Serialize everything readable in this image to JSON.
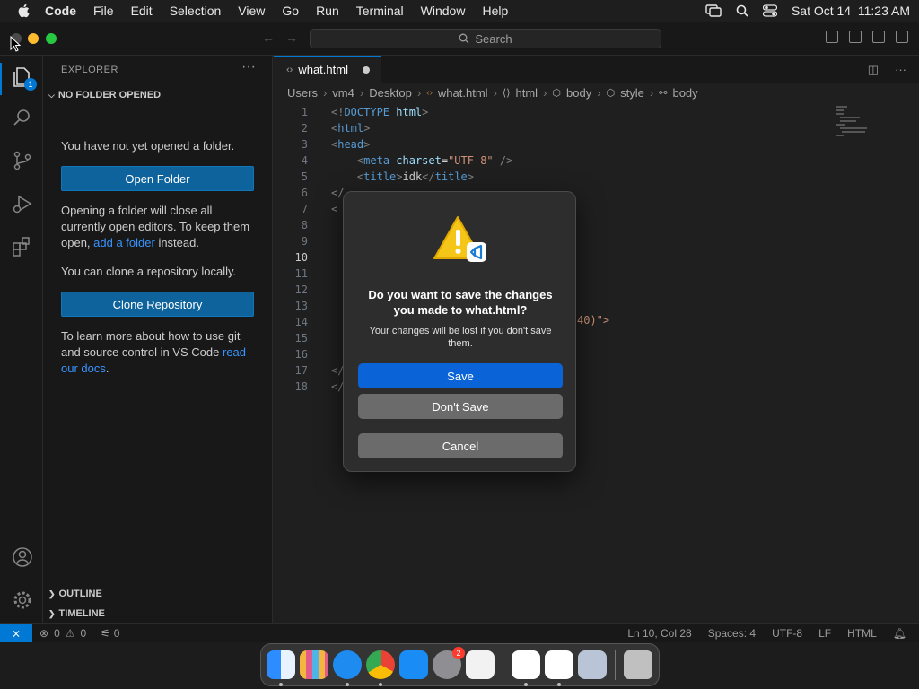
{
  "menubar": {
    "items": [
      "Code",
      "File",
      "Edit",
      "Selection",
      "View",
      "Go",
      "Run",
      "Terminal",
      "Window",
      "Help"
    ],
    "datetime": "Sat Oct 14  11:23 AM"
  },
  "titlebar": {
    "search_placeholder": "Search"
  },
  "activitybar": {
    "badge": "1"
  },
  "sidebar": {
    "title": "EXPLORER",
    "section": "NO FOLDER OPENED",
    "no_folder_text": "You have not yet opened a folder.",
    "open_folder_button": "Open Folder",
    "opening_text_1": "Opening a folder will close all currently open editors. To keep them open, ",
    "add_folder_link": "add a folder",
    "opening_text_2": " instead.",
    "clone_text": "You can clone a repository locally.",
    "clone_button": "Clone Repository",
    "git_text_1": "To learn more about how to use git and source control in VS Code ",
    "read_docs_link": "read our docs",
    "git_text_2": ".",
    "outline": "OUTLINE",
    "timeline": "TIMELINE"
  },
  "editor": {
    "tab_label": "what.html",
    "breadcrumb": [
      "Users",
      "vm4",
      "Desktop",
      "what.html",
      "html",
      "body",
      "style",
      "body"
    ],
    "line_numbers": [
      "1",
      "2",
      "3",
      "4",
      "5",
      "6",
      "7",
      "8",
      "9",
      "10",
      "11",
      "12",
      "13",
      "14",
      "15",
      "16",
      "17",
      "18"
    ],
    "current_line": "10",
    "code": {
      "l1_open": "<!",
      "l1_doctype": "DOCTYPE",
      "l1_html": " html",
      "l1_close": ">",
      "l2": "html",
      "l3": "head",
      "l4_tag": "meta",
      "l4_attr": " charset",
      "l4_eq": "=",
      "l4_val": "\"UTF-8\"",
      "l4_close": " />",
      "l5_tag": "title",
      "l5_text": "idk",
      "l6": "</",
      "l7": "<",
      "l17": "</",
      "l18": "</",
      "l14_fragment": "40)\">"
    }
  },
  "statusbar": {
    "errors": "0",
    "warnings": "0",
    "ports": "0",
    "position": "Ln 10, Col 28",
    "spaces": "Spaces: 4",
    "encoding": "UTF-8",
    "eol": "LF",
    "language": "HTML"
  },
  "dialog": {
    "title": "Do you want to save the changes you made to what.html?",
    "message": "Your changes will be lost if you don't save them.",
    "save": "Save",
    "dont_save": "Don't Save",
    "cancel": "Cancel"
  },
  "dock": {
    "settings_badge": "2"
  },
  "colors": {
    "accent": "#0078d4",
    "button_blue": "#0a64d8",
    "sidebar_button": "#0e639c"
  }
}
